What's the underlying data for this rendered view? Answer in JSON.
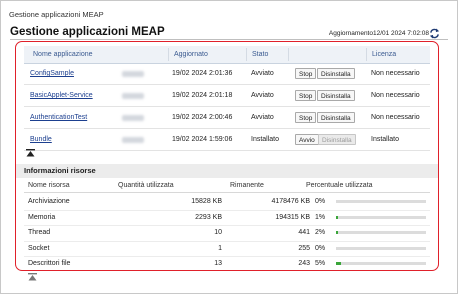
{
  "breadcrumb": "Gestione applicazioni MEAP",
  "title": "Gestione applicazioni MEAP",
  "updated": "Aggiornamento12/01 2024 7:02:08",
  "apps": {
    "columns": {
      "name": "Nome applicazione",
      "updated": "Aggiornato",
      "status": "Stato",
      "license": "Licenza"
    },
    "rows": [
      {
        "name": "ConfigSample",
        "date": "19/02 2024 2:01:36",
        "status": "Avviato",
        "button1": "Stop",
        "button2": "Disinstalla",
        "button2_disabled": false,
        "license": "Non necessario"
      },
      {
        "name": "BasicApplet-Service",
        "date": "19/02 2024 2:01:18",
        "status": "Avviato",
        "button1": "Stop",
        "button2": "Disinstalla",
        "button2_disabled": false,
        "license": "Non necessario"
      },
      {
        "name": "AuthenticationTest",
        "date": "19/02 2024 2:00:46",
        "status": "Avviato",
        "button1": "Stop",
        "button2": "Disinstalla",
        "button2_disabled": false,
        "license": "Non necessario"
      },
      {
        "name": "Bundle",
        "date": "19/02 2024 1:59:06",
        "status": "Installato",
        "button1": "Avvio",
        "button2": "Disinstalla",
        "button2_disabled": true,
        "license": "Installato"
      }
    ]
  },
  "resources": {
    "title": "Informazioni risorse",
    "columns": {
      "name": "Nome risorsa",
      "used": "Quantità utilizzata",
      "remaining": "Rimanente",
      "percent": "Percentuale utilizzata"
    },
    "rows": [
      {
        "name": "Archiviazione",
        "used": "15828 KB",
        "remaining": "4178476 KB",
        "percent": "0%",
        "fraction": 0.0
      },
      {
        "name": "Memoria",
        "used": "2293 KB",
        "remaining": "194315 KB",
        "percent": "1%",
        "fraction": 0.01
      },
      {
        "name": "Thread",
        "used": "10",
        "remaining": "441",
        "percent": "2%",
        "fraction": 0.02
      },
      {
        "name": "Socket",
        "used": "1",
        "remaining": "255",
        "percent": "0%",
        "fraction": 0.0
      },
      {
        "name": "Descrittori file",
        "used": "13",
        "remaining": "243",
        "percent": "5%",
        "fraction": 0.05
      }
    ]
  },
  "colors": {
    "highlight": "#e0202a",
    "link": "#1c3f8f",
    "bar_fill": "#3aa63a"
  },
  "icons": [
    "refresh-icon",
    "collapse-icon"
  ]
}
